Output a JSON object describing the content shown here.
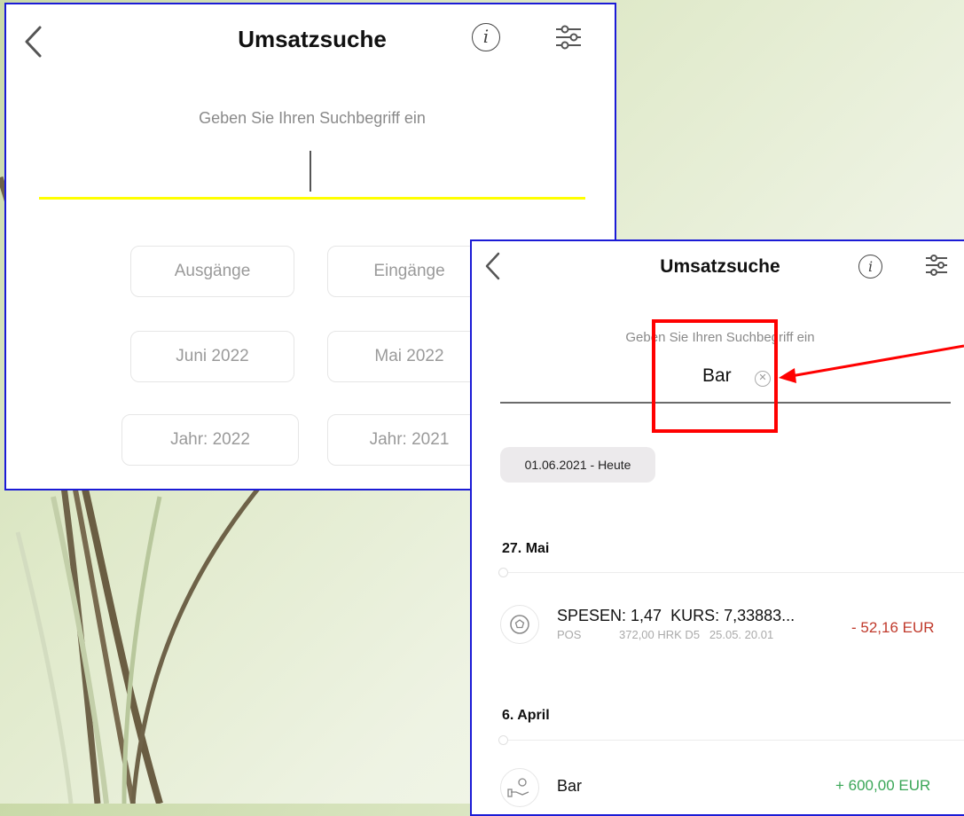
{
  "screen1": {
    "title": "Umsatzsuche",
    "search_prompt": "Geben Sie Ihren Suchbegriff ein",
    "accent_color": "#ffff00",
    "chips": {
      "outgoing": "Ausgänge",
      "incoming": "Eingänge",
      "month_current": "Juni 2022",
      "month_previous": "Mai 2022",
      "year_current": "Jahr: 2022",
      "year_previous": "Jahr: 2021"
    }
  },
  "screen2": {
    "title": "Umsatzsuche",
    "search_prompt": "Geben Sie Ihren Suchbegriff ein",
    "search_value": "Bar",
    "date_range": "01.06.2021 - Heute",
    "groups": [
      {
        "date": "27. Mai",
        "items": [
          {
            "title": "SPESEN: 1,47  KURS: 7,33883...",
            "type": "POS",
            "details": "372,00 HRK D5   25.05. 20.01",
            "amount": "- 52,16 EUR",
            "icon": "soccer-ball-icon"
          }
        ]
      },
      {
        "date": "6. April",
        "items": [
          {
            "title": "Bar",
            "amount": "+ 600,00 EUR",
            "icon": "cash-hand-icon"
          }
        ]
      }
    ],
    "colors": {
      "negative": "#c0392b",
      "positive": "#3aa657",
      "highlight": "#ff0000"
    }
  }
}
